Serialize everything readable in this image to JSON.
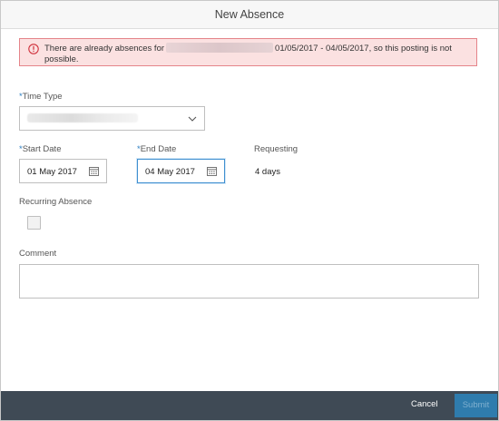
{
  "dialog": {
    "title": "New Absence"
  },
  "message": {
    "text_before": "There are already absences for",
    "text_after": "01/05/2017 - 04/05/2017, so this posting is not possible."
  },
  "form": {
    "time_type": {
      "required_mark": "*",
      "label": "Time Type"
    },
    "start_date": {
      "required_mark": "*",
      "label": "Start Date",
      "value": "01 May 2017"
    },
    "end_date": {
      "required_mark": "*",
      "label": "End Date",
      "value": "04 May 2017"
    },
    "requesting": {
      "label": "Requesting",
      "value": "4 days"
    },
    "recurring": {
      "label": "Recurring Absence",
      "checked": false
    },
    "comment": {
      "label": "Comment",
      "value": ""
    }
  },
  "footer": {
    "cancel_label": "Cancel",
    "submit_label": "Submit"
  },
  "colors": {
    "error_bg": "#fbe1e1",
    "error_border": "#e5848a",
    "error_icon": "#d0313c",
    "required": "#2b7ec1",
    "footer_bg": "#3f4a55",
    "submit_bg": "#2f7cad"
  }
}
